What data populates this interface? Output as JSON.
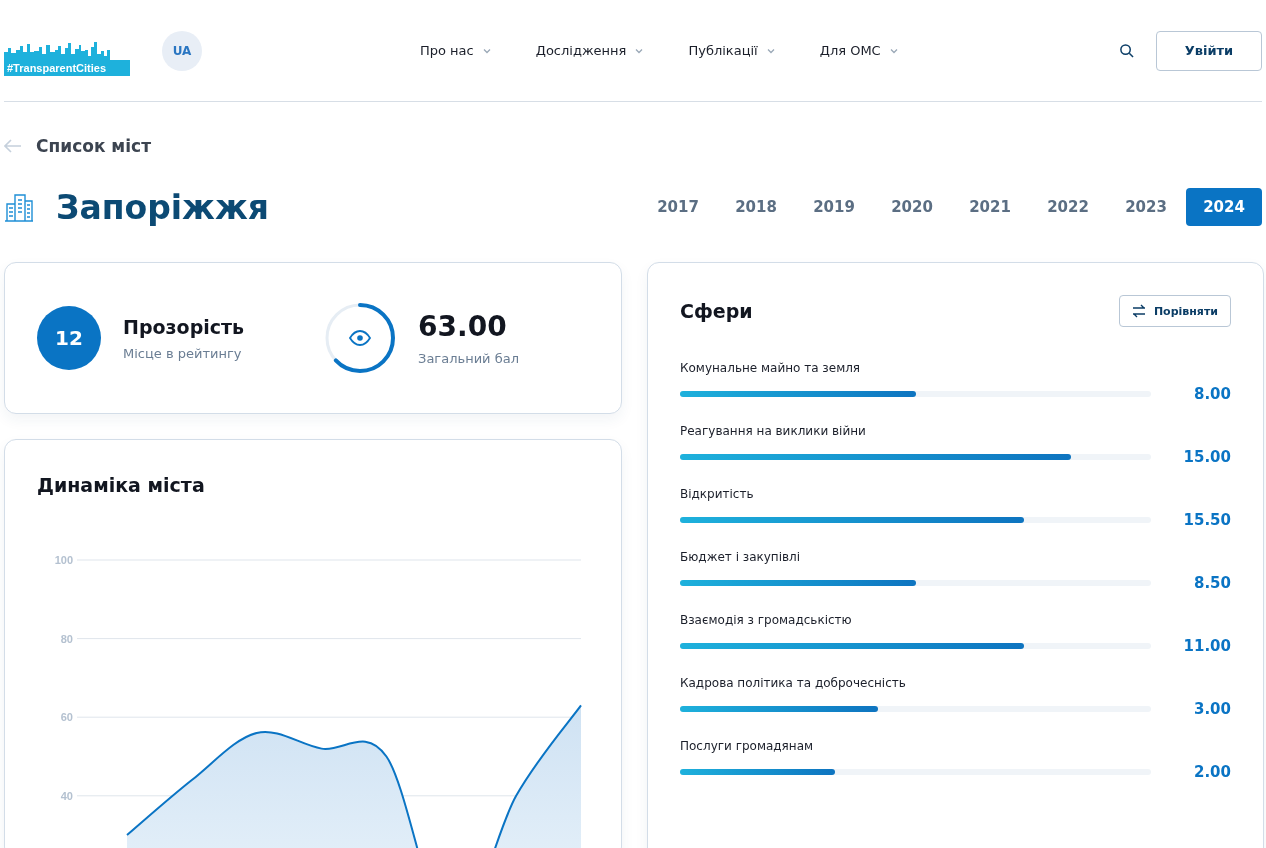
{
  "header": {
    "logo": "#TransparentCities",
    "language": "UA",
    "nav": [
      {
        "label": "Про нас"
      },
      {
        "label": "Дослідження"
      },
      {
        "label": "Публікації"
      },
      {
        "label": "Для ОМС"
      }
    ],
    "login": "Увійти"
  },
  "back_link": "Список міст",
  "city": "Запоріжжя",
  "years": [
    {
      "label": "2017",
      "selected": false
    },
    {
      "label": "2018",
      "selected": false
    },
    {
      "label": "2019",
      "selected": false
    },
    {
      "label": "2020",
      "selected": false
    },
    {
      "label": "2021",
      "selected": false
    },
    {
      "label": "2022",
      "selected": false
    },
    {
      "label": "2023",
      "selected": false
    },
    {
      "label": "2024",
      "selected": true
    }
  ],
  "summary": {
    "rank": "12",
    "title": "Прозорість",
    "subtitle": "Місце в рейтингу",
    "score": "63.00",
    "score_label": "Загальний бал",
    "level": 0.63
  },
  "dynamics": {
    "title": "Динаміка міста",
    "chart_data": {
      "type": "area",
      "grid": true,
      "ylim": [
        0,
        100
      ],
      "yticks": [
        40,
        60,
        80,
        100
      ],
      "series": [
        {
          "color": "#0a74c4",
          "values": [
            30,
            44,
            56,
            52,
            50,
            5,
            40,
            63
          ]
        }
      ]
    }
  },
  "spheres": {
    "title": "Сфери",
    "compare": "Порівняти",
    "items": [
      {
        "label": "Комунальне майно та земля",
        "value": "8.00",
        "level": 0.5
      },
      {
        "label": "Реагування на виклики війни",
        "value": "15.00",
        "level": 0.83
      },
      {
        "label": "Відкритість",
        "value": "15.50",
        "level": 0.73
      },
      {
        "label": "Бюджет і закупівлі",
        "value": "8.50",
        "level": 0.5
      },
      {
        "label": "Взаємодія з громадськістю",
        "value": "11.00",
        "level": 0.73
      },
      {
        "label": "Кадрова політика та доброчесність",
        "value": "3.00",
        "level": 0.42
      },
      {
        "label": "Послуги громадянам",
        "value": "2.00",
        "level": 0.33
      }
    ]
  }
}
